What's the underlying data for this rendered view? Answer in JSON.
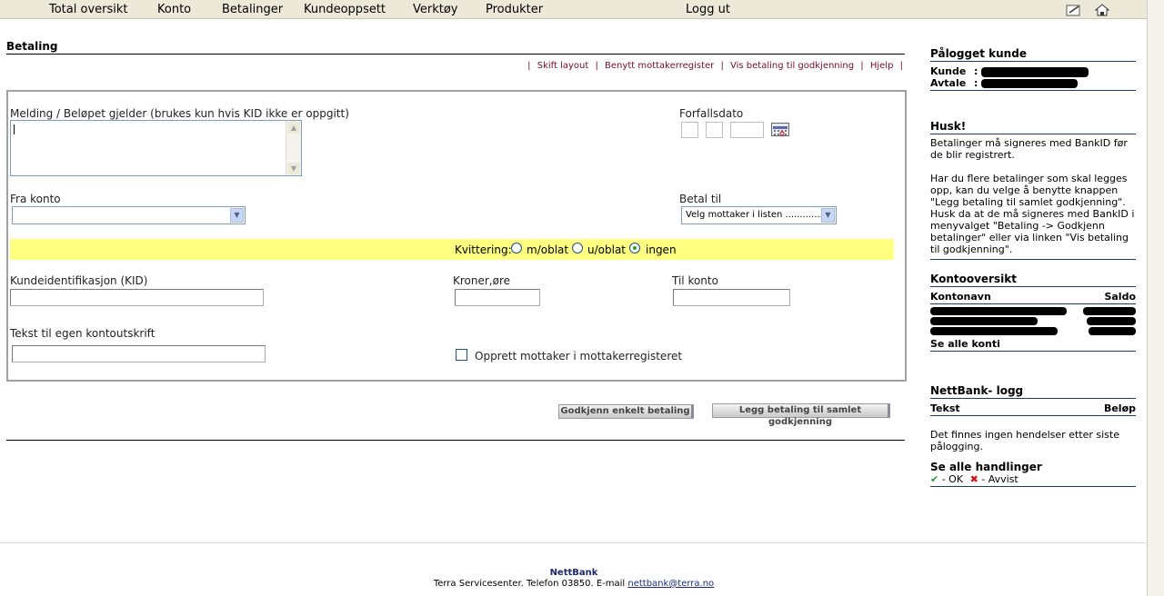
{
  "nav": {
    "items": [
      "Total oversikt",
      "Konto",
      "Betalinger",
      "Kundeoppsett",
      "Verktøy",
      "Produkter"
    ],
    "logout": "Logg ut",
    "icons": [
      "edit-icon",
      "home-icon"
    ]
  },
  "page": {
    "title": "Betaling",
    "links": [
      "Skift layout",
      "Benytt mottakerregister",
      "Vis betaling til godkjenning",
      "Hjelp"
    ]
  },
  "form": {
    "message_label": "Melding / Beløpet gjelder (brukes kun hvis KID ikke er oppgitt)",
    "message_value": "",
    "due_label": "Forfallsdato",
    "from_label": "Fra konto",
    "from_value": "",
    "payto_label": "Betal til",
    "payto_value": "Velg mottaker i listen ..............",
    "receipt_label": "Kvittering:",
    "receipt_options": [
      "m/oblat",
      "u/oblat",
      "ingen"
    ],
    "receipt_selected": "ingen",
    "kid_label": "Kundeidentifikasjon (KID)",
    "amount_label": "Kroner,øre",
    "toaccount_label": "Til konto",
    "owntext_label": "Tekst til egen kontoutskrift",
    "create_recipient_label": "Opprett mottaker i mottakerregisteret",
    "create_recipient_checked": false
  },
  "buttons": {
    "approve_single": "Godkjenn enkelt betaling",
    "add_to_batch": "Legg betaling til samlet godkjenning"
  },
  "sidebar": {
    "logged_in_title": "Pålogget kunde",
    "customer_label": "Kunde",
    "agreement_label": "Avtale",
    "remember_title": "Husk!",
    "remember_text_1": "Betalinger må signeres med BankID før de blir registrert.",
    "remember_text_2": "Har du flere betalinger som skal legges opp, kan du velge å benytte knappen \"Legg betaling til samlet godkjenning\". Husk da at de må signeres med BankID i menyvalget \"Betaling -> Godkjenn betalinger\" eller via linken \"Vis betaling til godkjenning\".",
    "accounts_title": "Kontooversikt",
    "accounts_col_name": "Kontonavn",
    "accounts_col_balance": "Saldo",
    "see_all_accounts": "Se alle konti",
    "log_title": "NettBank- logg",
    "log_col_text": "Tekst",
    "log_col_amount": "Beløp",
    "log_empty": "Det finnes ingen hendelser etter siste pålogging.",
    "see_all_actions": "Se alle handlinger",
    "legend_ok": "- OK",
    "legend_rejected": "- Avvist"
  },
  "footer": {
    "brand": "NettBank",
    "contact": "Terra Servicesenter. Telefon 03850. E-mail ",
    "email": "nettbank@terra.no"
  }
}
